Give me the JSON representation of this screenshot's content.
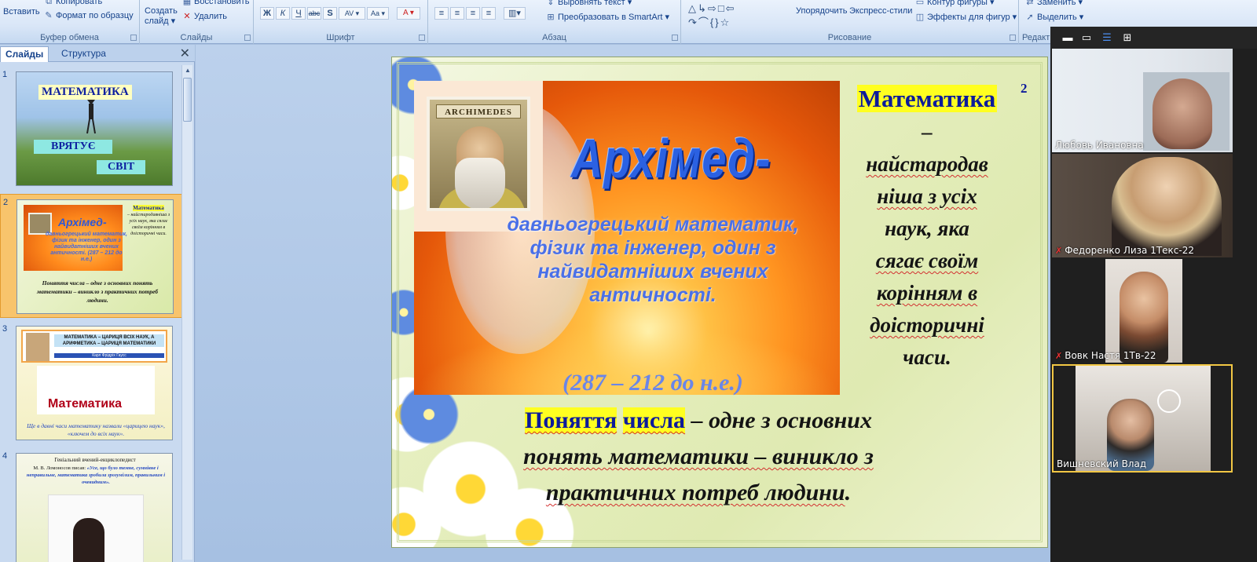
{
  "ribbon": {
    "clipboard": {
      "paste": "Вставить",
      "copy": "Копировать",
      "format_painter": "Формат по образцу",
      "label": "Буфер обмена"
    },
    "slides": {
      "new_slide": "Создать слайд ▾",
      "restore": "Восстановить",
      "delete": "Удалить",
      "label": "Слайды"
    },
    "font": {
      "label": "Шрифт"
    },
    "paragraph": {
      "align_text": "Выровнять текст ▾",
      "smartart": "Преобразовать в SmartArt ▾",
      "label": "Абзац"
    },
    "drawing": {
      "arrange": "Упорядочить",
      "quick_styles": "Экспресс-стили",
      "shape_outline": "Контур фигуры ▾",
      "shape_effects": "Эффекты для фигур ▾",
      "label": "Рисование"
    },
    "editing": {
      "replace": "Заменить ▾",
      "select": "Выделить ▾",
      "label": "Редакт"
    }
  },
  "left_pane": {
    "tabs": [
      "Слайды",
      "Структура"
    ],
    "close_glyph": "✕",
    "thumbs": {
      "t1": {
        "num": "1",
        "title": "МАТЕМАТИКА",
        "w2": "ВРЯТУЄ",
        "w3": "СВІТ"
      },
      "t2": {
        "num": "2",
        "title": "Архімед-",
        "sub": "давньогрецький математик, фізик та інженер, один з найвидатніших вчених античності. (287 – 212 до н.е.)",
        "right_head": "Математика",
        "right_text": "– найстародавніша з усіх наук, яка сягає своїм корінням в доісторичні часи.",
        "bottom": "Поняття числа – одне з основних понять математики – виникло з практичних потреб людини."
      },
      "t3": {
        "num": "3",
        "banner1": "МАТЕМАТИКА – ЦАРИЦЯ ВСІХ НАУК, А АРИФМЕТИКА – ЦАРИЦЯ МАТЕМАТИКИ",
        "banner2": "Карл Фрідріх Гаусс",
        "word": "Математика",
        "bottom": "Ще в давні часи математику назвали «царицею наук», «ключем до всіх наук»."
      },
      "t4": {
        "num": "4",
        "title": "Геніальний вчений-енциклопедист",
        "quote_a": "М. В. Ломоносов писав:",
        "quote_b": "«Усе, що було темне, сумнівне і неправильне, математика зробила зрозумілим, правильним і очевидним»."
      }
    }
  },
  "slide": {
    "number": "2",
    "portrait_banner": "ARCHIMEDES",
    "arch_title": "Архімед-",
    "arch_sub": "давньогрецький математик, фізик та інженер, один з найвидатніших вчених античності.",
    "arch_dates": "(287 – 212 до н.е.)",
    "right": {
      "head": "Математика",
      "dash": "–",
      "l1": "найстародав",
      "l2": "ніша з усіх",
      "l3": "наук, яка",
      "l4": "сягає своїм",
      "l5": "корінням в",
      "l6": "доісторичні",
      "l7": "часи."
    },
    "bottom": {
      "w1": "Поняття",
      "w2": "числа",
      "rest1": " – одне з основних",
      "rest2": "понять математики – виникло з",
      "rest3": "практичних потреб людини",
      "dot": "."
    }
  },
  "zoom": {
    "participants": [
      {
        "name": "Любовь Ивановна",
        "muted": false
      },
      {
        "name": "Федоренко Лиза 1Текс-22",
        "muted": true
      },
      {
        "name": "Вовк Настя 1Тв-22",
        "muted": true
      },
      {
        "name": "Вишневский Влад",
        "muted": false
      }
    ],
    "mute_glyph": "✗"
  },
  "colors": {
    "ribbon_text": "#15428b",
    "highlight_yellow": "#ffff20",
    "title_blue": "#2b61e2",
    "zoom_bg": "#1f1f1f"
  }
}
